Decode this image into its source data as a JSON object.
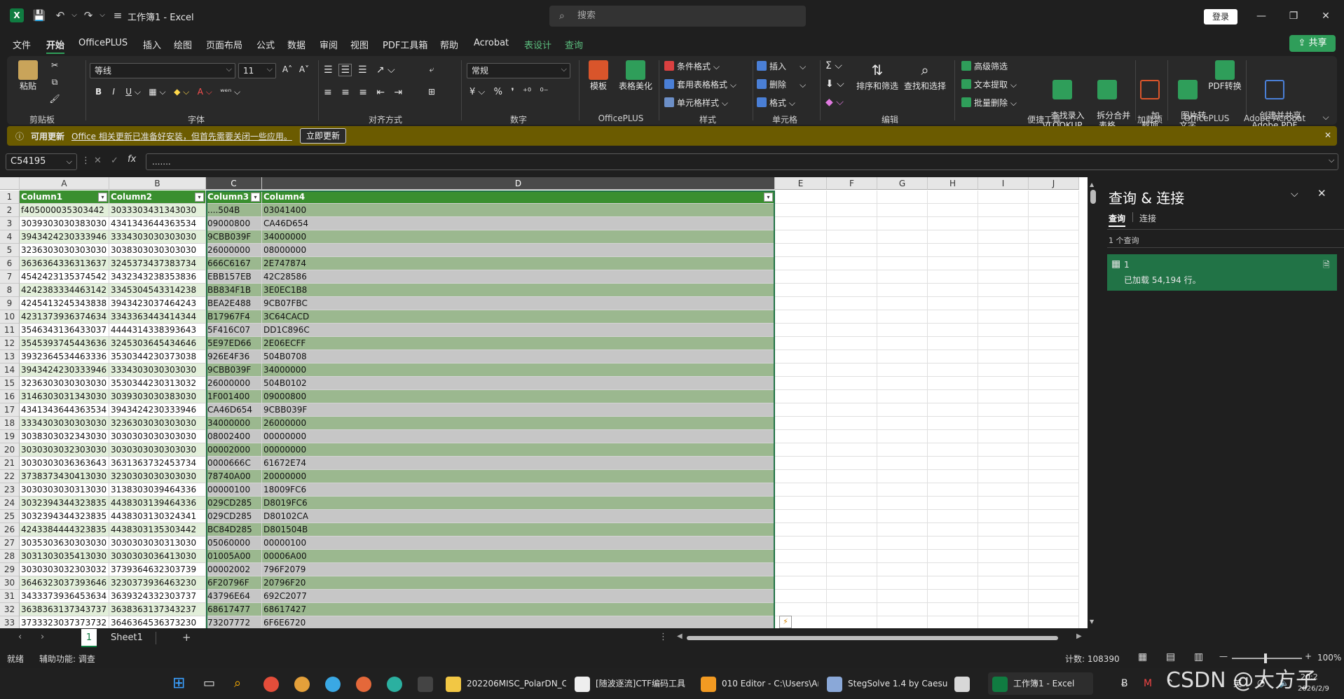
{
  "titlebar": {
    "title": "工作簿1 - Excel",
    "search_placeholder": "搜索",
    "login_label": "登录",
    "autosave_glyph": "▾"
  },
  "menu": {
    "items": [
      "文件",
      "开始",
      "OfficePLUS",
      "插入",
      "绘图",
      "页面布局",
      "公式",
      "数据",
      "审阅",
      "视图",
      "PDF工具箱",
      "帮助",
      "Acrobat",
      "表设计",
      "查询"
    ],
    "share_label": "共享"
  },
  "ribbon": {
    "paste_label": "粘贴",
    "clipboard_label": "剪贴板",
    "font_name": "等线",
    "font_size": "11",
    "font_label": "字体",
    "align_label": "对齐方式",
    "number_format": "常规",
    "number_label": "数字",
    "template_label": "模板",
    "beautify_label": "表格美化",
    "officeplus_label": "OfficePLUS",
    "cond_format": "条件格式",
    "table_format": "套用表格格式",
    "cell_style": "单元格样式",
    "style_label": "样式",
    "insert": "插入",
    "delete": "删除",
    "format": "格式",
    "cells_label": "单元格",
    "sort_filter": "排序和筛选",
    "find_select": "查找和选择",
    "edit_label": "编辑",
    "adv_filter": "高级筛选",
    "text_extract": "文本提取",
    "batch_delete": "批量删除",
    "lookup_entry": "查找录入\nVLOOKUP",
    "split_merge": "拆分合并\n表格",
    "tools_label": "便捷工具",
    "addin_btn": "加\n载项",
    "addin_label": "加载项",
    "img2text": "图片转\n文字",
    "pdf_convert": "PDF转换",
    "officeplus2_label": "OfficePLUS",
    "create_share_pdf": "创建并共享\nAdobe PDF",
    "acrobat_label": "Adobe Acrobat"
  },
  "update_bar": {
    "title": "可用更新",
    "message": "Office 相关更新已准备好安装，但首先需要关闭一些应用。",
    "button": "立即更新"
  },
  "formula_bar": {
    "name_box": "C54195",
    "formula": "......."
  },
  "sheet": {
    "col_letters": [
      "A",
      "B",
      "C",
      "D",
      "E",
      "F",
      "G",
      "H",
      "I",
      "J"
    ],
    "headers": [
      "Column1",
      "Column2",
      "Column3",
      "Column4"
    ],
    "row_numbers": [
      "1",
      "2",
      "3",
      "4",
      "5",
      "6",
      "7",
      "8",
      "9",
      "10",
      "11",
      "12",
      "13",
      "14",
      "15",
      "16",
      "17",
      "18",
      "19",
      "20",
      "21",
      "22",
      "23",
      "24",
      "25",
      "26",
      "27",
      "28",
      "29",
      "30",
      "31",
      "32",
      "33"
    ],
    "rows": [
      [
        "f405000035303442",
        "3033303431343030",
        "....504B",
        "03041400"
      ],
      [
        "3039303030383030",
        "4341343644363534",
        "09000800",
        "CA46D654"
      ],
      [
        "3943424230333946",
        "3334303030303030",
        "9CBB039F",
        "34000000"
      ],
      [
        "3236303030303030",
        "3038303030303030",
        "26000000",
        "08000000"
      ],
      [
        "3636364336313637",
        "3245373437383734",
        "666C6167",
        "2E747874"
      ],
      [
        "4542423135374542",
        "3432343238353836",
        "EBB157EB",
        "42C28586"
      ],
      [
        "4242383334463142",
        "3345304543314238",
        "BB834F1B",
        "3E0EC1B8"
      ],
      [
        "4245413245343838",
        "3943423037464243",
        "BEA2E488",
        "9CB07FBC"
      ],
      [
        "4231373936374634",
        "3343363443414344",
        "B17967F4",
        "3C64CACD"
      ],
      [
        "3546343136433037",
        "4444314338393643",
        "5F416C07",
        "DD1C896C"
      ],
      [
        "3545393745443636",
        "3245303645434646",
        "5E97ED66",
        "2E06ECFF"
      ],
      [
        "3932364534463336",
        "3530344230373038",
        "926E4F36",
        "504B0708"
      ],
      [
        "3943424230333946",
        "3334303030303030",
        "9CBB039F",
        "34000000"
      ],
      [
        "3236303030303030",
        "3530344230313032",
        "26000000",
        "504B0102"
      ],
      [
        "3146303031343030",
        "3039303030383030",
        "1F001400",
        "09000800"
      ],
      [
        "4341343644363534",
        "3943424230333946",
        "CA46D654",
        "9CBB039F"
      ],
      [
        "3334303030303030",
        "3236303030303030",
        "34000000",
        "26000000"
      ],
      [
        "3038303032343030",
        "3030303030303030",
        "08002400",
        "00000000"
      ],
      [
        "3030303032303030",
        "3030303030303030",
        "00002000",
        "00000000"
      ],
      [
        "3030303036363643",
        "3631363732453734",
        "0000666C",
        "61672E74"
      ],
      [
        "3738373430413030",
        "3230303030303030",
        "78740A00",
        "20000000"
      ],
      [
        "3030303030313030",
        "3138303039464336",
        "00000100",
        "18009FC6"
      ],
      [
        "3032394344323835",
        "4438303139464336",
        "029CD285",
        "D8019FC6"
      ],
      [
        "3032394344323835",
        "4438303130324341",
        "029CD285",
        "D80102CA"
      ],
      [
        "4243384444323835",
        "4438303135303442",
        "BC84D285",
        "D801504B"
      ],
      [
        "3035303630303030",
        "3030303030313030",
        "05060000",
        "00000100"
      ],
      [
        "3031303035413030",
        "3030303036413030",
        "01005A00",
        "00006A00"
      ],
      [
        "3030303032303032",
        "3739364632303739",
        "00002002",
        "796F2079"
      ],
      [
        "3646323037393646",
        "3230373936463230",
        "6F20796F",
        "20796F20"
      ],
      [
        "3433373936453634",
        "3639324332303737",
        "43796E64",
        "692C2077"
      ],
      [
        "3638363137343737",
        "3638363137343237",
        "68617477",
        "68617427"
      ],
      [
        "3733323037373732",
        "3646364536373230",
        "73207772",
        "6F6E6720"
      ]
    ]
  },
  "sheet_tabs": {
    "tab1": "1",
    "tab2": "Sheet1",
    "add": "+"
  },
  "query_panel": {
    "title": "查询 & 连接",
    "tab_queries": "查询",
    "tab_connections": "连接",
    "count": "1 个查询",
    "query_name": "1",
    "query_status": "已加载 54,194 行。"
  },
  "status_bar": {
    "ready": "就绪",
    "accessibility": "辅助功能: 调查",
    "count": "计数: 108390",
    "zoom": "100%"
  },
  "taskbar": {
    "items": [
      "202206MISC_PolarDN_C",
      "[随波逐流]CTF编码工具",
      "010 Editor - C:\\Users\\An",
      "StegSolve 1.4 by Caesun",
      "工作簿1 - Excel"
    ],
    "lang": "英",
    "time": "20:2",
    "date": "2026/2/9",
    "watermark": "CSDN @大方子"
  },
  "colors": {
    "excel_green": "#107c41",
    "table_header": "#3a8f2f",
    "row_band_light": "#e2efda",
    "selection_tint": "#9bb88f",
    "update_bar": "#6b5b00",
    "query_selected": "#217346"
  }
}
